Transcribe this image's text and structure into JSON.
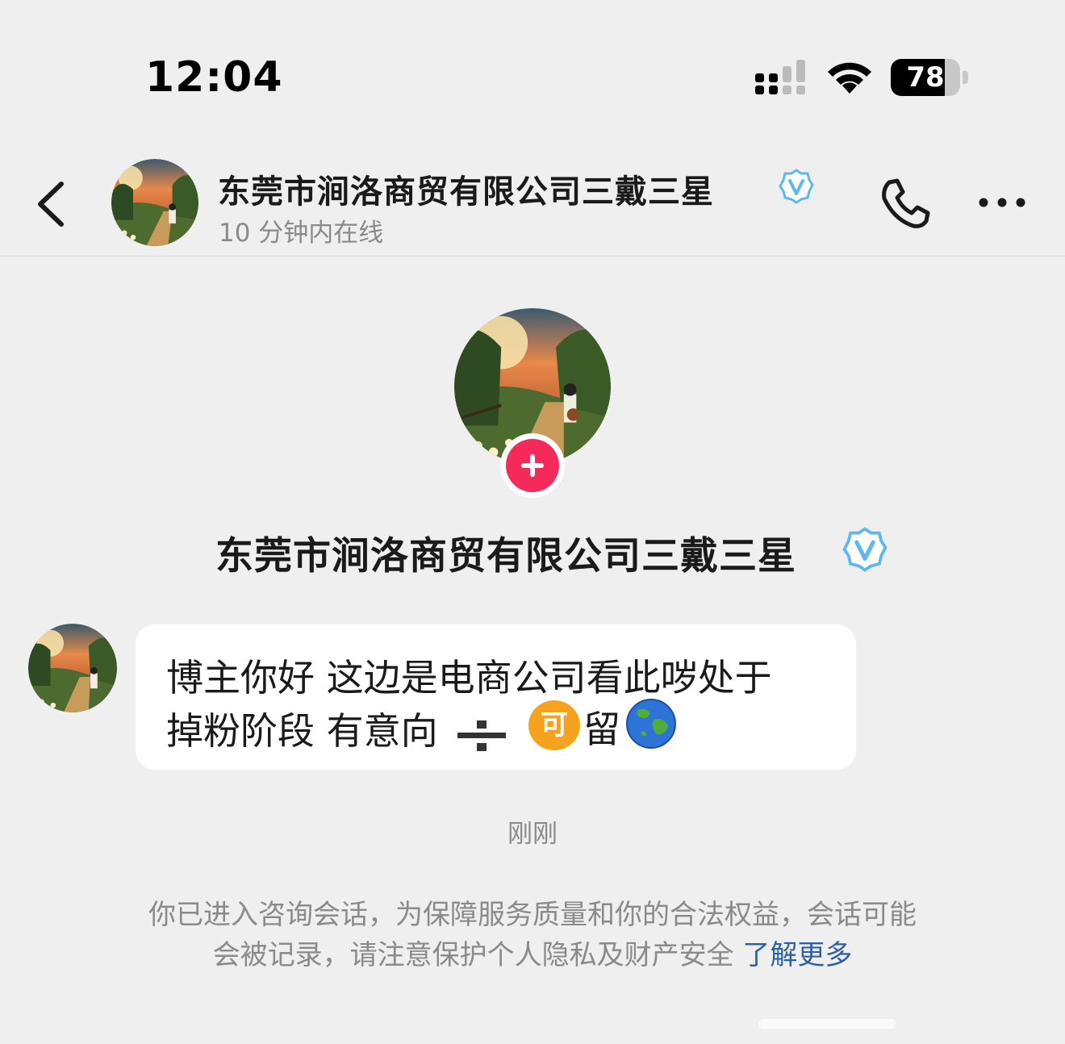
{
  "status_bar": {
    "time": "12:04",
    "battery": "78",
    "battery_fraction": 0.78
  },
  "header": {
    "name": "东莞市涧洛商贸有限公司三戴三星",
    "online_status": "10 分钟内在线",
    "back_icon": "chevron-left-icon",
    "call_icon": "phone-icon",
    "more_icon": "more-icon"
  },
  "profile": {
    "name": "东莞市涧洛商贸有限公司三戴三星",
    "follow_icon": "plus-icon"
  },
  "message": {
    "line1": "博主你好 这边是电商公司看此哕处于",
    "line2": "掉粉阶段 有意向",
    "emoji_badge": "可",
    "tail_char": "留",
    "globe_icon": "globe-icon"
  },
  "timestamp": "刚刚",
  "notice": {
    "line1": "你已进入咨询会话，为保障服务质量和你的合法权益，会话可能",
    "line2": "会被记录，请注意保护个人隐私及财产安全",
    "link": "了解更多"
  },
  "colors": {
    "background": "#efefef",
    "follow_button": "#f52a5a",
    "verified": "#5fb7ee",
    "link": "#2c5fa8",
    "emoji_badge": "#f5a21e"
  }
}
